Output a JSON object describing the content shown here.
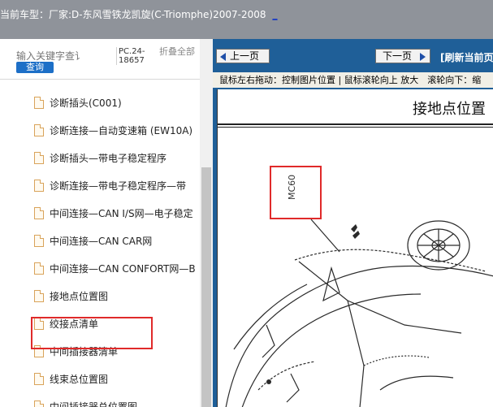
{
  "header": {
    "model_label": "当前车型：",
    "model_value": "厂家:D-东风雪铁龙凯旋(C-Triomphe)2007-2008",
    "link_text": "_"
  },
  "search": {
    "placeholder": "输入关键字查讠",
    "button": "查询",
    "pc_code": "PC.24-18657",
    "fold_all": "折叠全部"
  },
  "tree": {
    "items": [
      {
        "label": "诊断插头(C001)"
      },
      {
        "label": "诊断连接—自动变速箱 (EW10A)"
      },
      {
        "label": "诊断插头—带电子稳定程序"
      },
      {
        "label": "诊断连接—带电子稳定程序—带"
      },
      {
        "label": "中间连接—CAN I/S网—电子稳定"
      },
      {
        "label": "中间连接—CAN CAR网"
      },
      {
        "label": "中间连接—CAN CONFORT网—B"
      },
      {
        "label": "接地点位置图"
      },
      {
        "label": "绞接点清单"
      },
      {
        "label": "中间插接器清单"
      },
      {
        "label": "线束总位置图"
      },
      {
        "label": "中间插接器总位置图"
      }
    ],
    "selected_index": 7
  },
  "viewer": {
    "prev": "上一页",
    "next": "下一页",
    "refresh": "[刷新当前页",
    "hint": "鼠标左右拖动：控制图片位置 | 鼠标滚轮向上 放大　滚轮向下：缩",
    "doc_title": "接地点位置",
    "marker": "MC60"
  },
  "colors": {
    "topbar": "#8f939a",
    "viewer_bg": "#1f5f98",
    "highlight": "#e02a2a",
    "query_button": "#1d6fc7"
  }
}
